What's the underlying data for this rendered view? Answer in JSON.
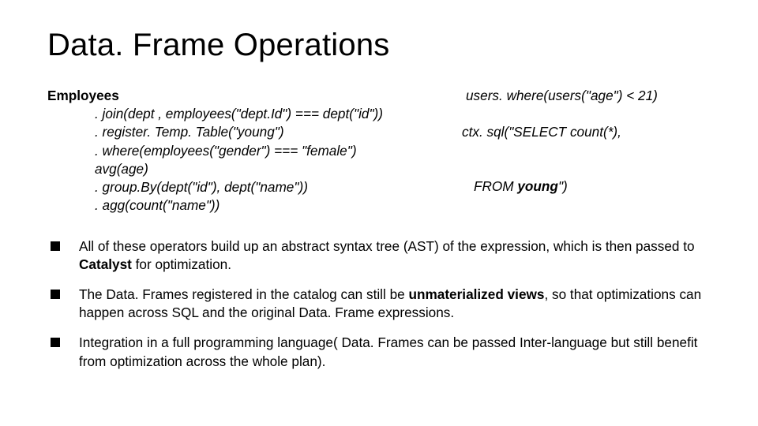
{
  "title": "Data. Frame Operations",
  "code": {
    "l1a": "Employees",
    "l2": ". join(dept , employees(\"dept.Id\") === dept(\"id\"))",
    "l3": ". register. Temp. Table(\"young\")",
    "l4": ". where(employees(\"gender\") === \"female\")",
    "l5": "avg(age)",
    "l6": ". group.By(dept(\"id\"), dept(\"name\"))",
    "l7": ". agg(count(\"name\"))",
    "r1": "users. where(users(\"age\") < 21)",
    "r2a": "ctx. sql(\"SELECT count(*),",
    "r3a": "FROM ",
    "r3b": "young",
    "r3c": "\")"
  },
  "bullets": [
    {
      "t1": "All of these operators build up an abstract syntax tree (AST) of the expression, which is then passed to ",
      "b1": "Catalyst",
      "t2": " for optimization."
    },
    {
      "t1": "The Data. Frames registered in the catalog can still be ",
      "b1": "unmaterialized views",
      "t2": ", so that optimizations can happen across SQL and the original Data. Frame expressions."
    },
    {
      "t1": "Integration in a full programming language( Data. Frames can be passed Inter-language but still benefit from optimization  across the whole plan).",
      "b1": "",
      "t2": ""
    }
  ]
}
